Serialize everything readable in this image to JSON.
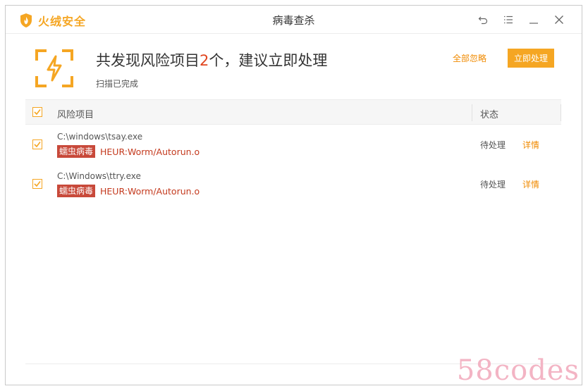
{
  "app": {
    "brand": "火绒安全",
    "window_title": "病毒查杀",
    "brand_color": "#f5a623"
  },
  "window_controls": {
    "back_icon": "undo-arrow-icon",
    "menu_icon": "menu-icon",
    "minimize_icon": "minimize-icon",
    "close_icon": "close-icon"
  },
  "summary": {
    "headline_prefix": "共发现风险项目",
    "count": "2",
    "headline_suffix": "个，建议立即处理",
    "subline": "扫描已完成",
    "icon": "lightning-frame-icon"
  },
  "actions": {
    "ignore_all": "全部忽略",
    "handle_now": "立即处理"
  },
  "table": {
    "col_item": "风险项目",
    "col_status": "状态",
    "rows": [
      {
        "checked": true,
        "path": "C:\\windows\\tsay.exe",
        "tag": "蠕虫病毒",
        "virus": "HEUR:Worm/Autorun.o",
        "status": "待处理",
        "details": "详情"
      },
      {
        "checked": true,
        "path": "C:\\Windows\\ttry.exe",
        "tag": "蠕虫病毒",
        "virus": "HEUR:Worm/Autorun.o",
        "status": "待处理",
        "details": "详情"
      }
    ]
  },
  "watermark": "58codes"
}
